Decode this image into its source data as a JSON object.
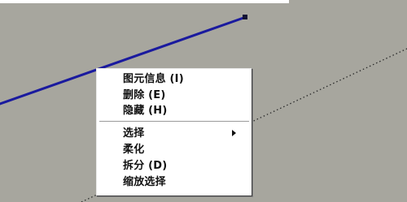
{
  "context_menu": {
    "items_group_1": [
      {
        "label": "图元信息 (I)"
      },
      {
        "label": "删除 (E)"
      },
      {
        "label": "隐藏 (H)"
      }
    ],
    "items_group_2": [
      {
        "label": "选择",
        "has_submenu": true
      },
      {
        "label": "柔化"
      },
      {
        "label": "拆分 (D)"
      },
      {
        "label": "缩放选择"
      }
    ]
  },
  "colors": {
    "canvas_background": "#a7a69e",
    "selected_edge": "#1a1a9e",
    "guide_line": "#2a2a2a",
    "menu_background": "#ffffff"
  }
}
